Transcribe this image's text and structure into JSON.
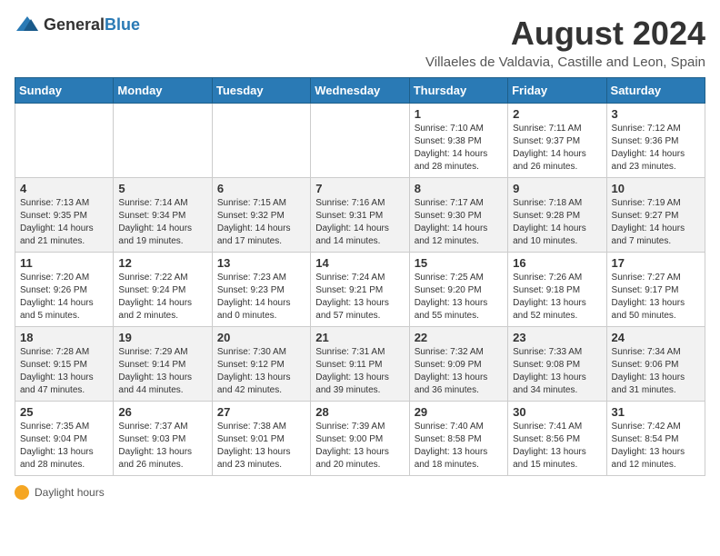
{
  "logo": {
    "general": "General",
    "blue": "Blue"
  },
  "title": "August 2024",
  "subtitle": "Villaeles de Valdavia, Castille and Leon, Spain",
  "days_header": [
    "Sunday",
    "Monday",
    "Tuesday",
    "Wednesday",
    "Thursday",
    "Friday",
    "Saturday"
  ],
  "weeks": [
    [
      {
        "day": "",
        "info": ""
      },
      {
        "day": "",
        "info": ""
      },
      {
        "day": "",
        "info": ""
      },
      {
        "day": "",
        "info": ""
      },
      {
        "day": "1",
        "sunrise": "Sunrise: 7:10 AM",
        "sunset": "Sunset: 9:38 PM",
        "daylight": "Daylight: 14 hours and 28 minutes."
      },
      {
        "day": "2",
        "sunrise": "Sunrise: 7:11 AM",
        "sunset": "Sunset: 9:37 PM",
        "daylight": "Daylight: 14 hours and 26 minutes."
      },
      {
        "day": "3",
        "sunrise": "Sunrise: 7:12 AM",
        "sunset": "Sunset: 9:36 PM",
        "daylight": "Daylight: 14 hours and 23 minutes."
      }
    ],
    [
      {
        "day": "4",
        "sunrise": "Sunrise: 7:13 AM",
        "sunset": "Sunset: 9:35 PM",
        "daylight": "Daylight: 14 hours and 21 minutes."
      },
      {
        "day": "5",
        "sunrise": "Sunrise: 7:14 AM",
        "sunset": "Sunset: 9:34 PM",
        "daylight": "Daylight: 14 hours and 19 minutes."
      },
      {
        "day": "6",
        "sunrise": "Sunrise: 7:15 AM",
        "sunset": "Sunset: 9:32 PM",
        "daylight": "Daylight: 14 hours and 17 minutes."
      },
      {
        "day": "7",
        "sunrise": "Sunrise: 7:16 AM",
        "sunset": "Sunset: 9:31 PM",
        "daylight": "Daylight: 14 hours and 14 minutes."
      },
      {
        "day": "8",
        "sunrise": "Sunrise: 7:17 AM",
        "sunset": "Sunset: 9:30 PM",
        "daylight": "Daylight: 14 hours and 12 minutes."
      },
      {
        "day": "9",
        "sunrise": "Sunrise: 7:18 AM",
        "sunset": "Sunset: 9:28 PM",
        "daylight": "Daylight: 14 hours and 10 minutes."
      },
      {
        "day": "10",
        "sunrise": "Sunrise: 7:19 AM",
        "sunset": "Sunset: 9:27 PM",
        "daylight": "Daylight: 14 hours and 7 minutes."
      }
    ],
    [
      {
        "day": "11",
        "sunrise": "Sunrise: 7:20 AM",
        "sunset": "Sunset: 9:26 PM",
        "daylight": "Daylight: 14 hours and 5 minutes."
      },
      {
        "day": "12",
        "sunrise": "Sunrise: 7:22 AM",
        "sunset": "Sunset: 9:24 PM",
        "daylight": "Daylight: 14 hours and 2 minutes."
      },
      {
        "day": "13",
        "sunrise": "Sunrise: 7:23 AM",
        "sunset": "Sunset: 9:23 PM",
        "daylight": "Daylight: 14 hours and 0 minutes."
      },
      {
        "day": "14",
        "sunrise": "Sunrise: 7:24 AM",
        "sunset": "Sunset: 9:21 PM",
        "daylight": "Daylight: 13 hours and 57 minutes."
      },
      {
        "day": "15",
        "sunrise": "Sunrise: 7:25 AM",
        "sunset": "Sunset: 9:20 PM",
        "daylight": "Daylight: 13 hours and 55 minutes."
      },
      {
        "day": "16",
        "sunrise": "Sunrise: 7:26 AM",
        "sunset": "Sunset: 9:18 PM",
        "daylight": "Daylight: 13 hours and 52 minutes."
      },
      {
        "day": "17",
        "sunrise": "Sunrise: 7:27 AM",
        "sunset": "Sunset: 9:17 PM",
        "daylight": "Daylight: 13 hours and 50 minutes."
      }
    ],
    [
      {
        "day": "18",
        "sunrise": "Sunrise: 7:28 AM",
        "sunset": "Sunset: 9:15 PM",
        "daylight": "Daylight: 13 hours and 47 minutes."
      },
      {
        "day": "19",
        "sunrise": "Sunrise: 7:29 AM",
        "sunset": "Sunset: 9:14 PM",
        "daylight": "Daylight: 13 hours and 44 minutes."
      },
      {
        "day": "20",
        "sunrise": "Sunrise: 7:30 AM",
        "sunset": "Sunset: 9:12 PM",
        "daylight": "Daylight: 13 hours and 42 minutes."
      },
      {
        "day": "21",
        "sunrise": "Sunrise: 7:31 AM",
        "sunset": "Sunset: 9:11 PM",
        "daylight": "Daylight: 13 hours and 39 minutes."
      },
      {
        "day": "22",
        "sunrise": "Sunrise: 7:32 AM",
        "sunset": "Sunset: 9:09 PM",
        "daylight": "Daylight: 13 hours and 36 minutes."
      },
      {
        "day": "23",
        "sunrise": "Sunrise: 7:33 AM",
        "sunset": "Sunset: 9:08 PM",
        "daylight": "Daylight: 13 hours and 34 minutes."
      },
      {
        "day": "24",
        "sunrise": "Sunrise: 7:34 AM",
        "sunset": "Sunset: 9:06 PM",
        "daylight": "Daylight: 13 hours and 31 minutes."
      }
    ],
    [
      {
        "day": "25",
        "sunrise": "Sunrise: 7:35 AM",
        "sunset": "Sunset: 9:04 PM",
        "daylight": "Daylight: 13 hours and 28 minutes."
      },
      {
        "day": "26",
        "sunrise": "Sunrise: 7:37 AM",
        "sunset": "Sunset: 9:03 PM",
        "daylight": "Daylight: 13 hours and 26 minutes."
      },
      {
        "day": "27",
        "sunrise": "Sunrise: 7:38 AM",
        "sunset": "Sunset: 9:01 PM",
        "daylight": "Daylight: 13 hours and 23 minutes."
      },
      {
        "day": "28",
        "sunrise": "Sunrise: 7:39 AM",
        "sunset": "Sunset: 9:00 PM",
        "daylight": "Daylight: 13 hours and 20 minutes."
      },
      {
        "day": "29",
        "sunrise": "Sunrise: 7:40 AM",
        "sunset": "Sunset: 8:58 PM",
        "daylight": "Daylight: 13 hours and 18 minutes."
      },
      {
        "day": "30",
        "sunrise": "Sunrise: 7:41 AM",
        "sunset": "Sunset: 8:56 PM",
        "daylight": "Daylight: 13 hours and 15 minutes."
      },
      {
        "day": "31",
        "sunrise": "Sunrise: 7:42 AM",
        "sunset": "Sunset: 8:54 PM",
        "daylight": "Daylight: 13 hours and 12 minutes."
      }
    ]
  ],
  "footer": {
    "daylight_label": "Daylight hours"
  }
}
